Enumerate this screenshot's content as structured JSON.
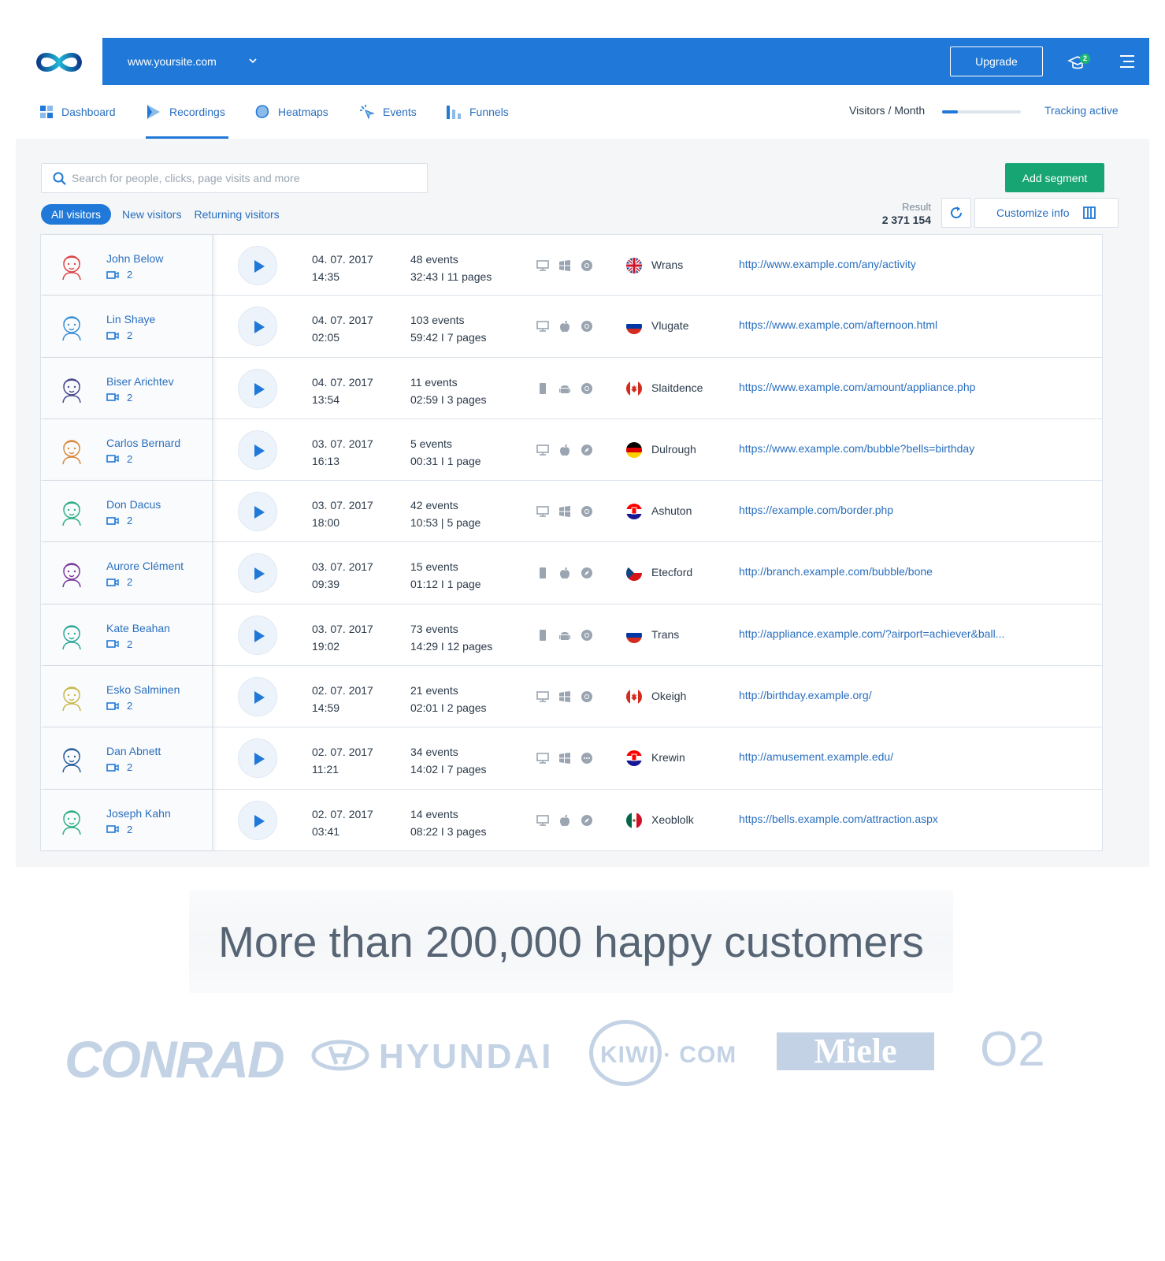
{
  "header": {
    "site": "www.yoursite.com",
    "upgrade_label": "Upgrade",
    "notification_count": "2"
  },
  "nav": {
    "items": [
      {
        "label": "Dashboard",
        "icon": "dashboard-icon"
      },
      {
        "label": "Recordings",
        "icon": "recordings-icon",
        "active": true
      },
      {
        "label": "Heatmaps",
        "icon": "heatmaps-icon"
      },
      {
        "label": "Events",
        "icon": "events-icon"
      },
      {
        "label": "Funnels",
        "icon": "funnels-icon"
      }
    ],
    "visitors_per_month_label": "Visitors / Month",
    "visitors_per_month_fill": 0.2,
    "tracking_label": "Tracking active"
  },
  "toolbar": {
    "search_placeholder": "Search for people, clicks, page visits and more",
    "add_segment_label": "Add segment",
    "filters": [
      "All visitors",
      "New visitors",
      "Returning visitors"
    ],
    "result_label": "Result",
    "result_value": "2 371 154",
    "customize_label": "Customize info"
  },
  "recordings": [
    {
      "name": "John Below",
      "recs": "2",
      "date": "04. 07. 2017",
      "time": "14:35",
      "events": "48 events",
      "duration": "32:43 I 11 pages",
      "device": "desktop",
      "os": "windows",
      "browser": "chrome",
      "flag": "uk",
      "city": "Wrans",
      "url": "http://www.example.com/any/activity",
      "color": "#d9484a"
    },
    {
      "name": "Lin Shaye",
      "recs": "2",
      "date": "04. 07. 2017",
      "time": "02:05",
      "events": "103 events",
      "duration": "59:42 I 7 pages",
      "device": "desktop",
      "os": "apple",
      "browser": "chrome",
      "flag": "ru",
      "city": "Vlugate",
      "url": "https://www.example.com/afternoon.html",
      "color": "#3a8fd6"
    },
    {
      "name": "Biser Arichtev",
      "recs": "2",
      "date": "04. 07. 2017",
      "time": "13:54",
      "events": "11 events",
      "duration": "02:59 I 3 pages",
      "device": "mobile",
      "os": "android",
      "browser": "chrome",
      "flag": "ca",
      "city": "Slaitdence",
      "url": "https://www.example.com/amount/appliance.php",
      "color": "#4a4a8c"
    },
    {
      "name": "Carlos Bernard",
      "recs": "2",
      "date": "03. 07. 2017",
      "time": "16:13",
      "events": "5 events",
      "duration": "00:31 I 1 page",
      "device": "desktop",
      "os": "apple",
      "browser": "safari",
      "flag": "de",
      "city": "Dulrough",
      "url": "https://www.example.com/bubble?bells=birthday",
      "color": "#d88a3c"
    },
    {
      "name": "Don Dacus",
      "recs": "2",
      "date": "03. 07. 2017",
      "time": "18:00",
      "events": "42 events",
      "duration": "10:53  |  5 page",
      "device": "desktop",
      "os": "windows",
      "browser": "chrome",
      "flag": "hr",
      "city": "Ashuton",
      "url": "https://example.com/border.php",
      "color": "#2fae86"
    },
    {
      "name": "Aurore Clément",
      "recs": "2",
      "date": "03. 07. 2017",
      "time": "09:39",
      "events": "15 events",
      "duration": "01:12 I 1 page",
      "device": "mobile",
      "os": "apple",
      "browser": "safari",
      "flag": "cz",
      "city": "Etecford",
      "url": "http://branch.example.com/bubble/bone",
      "color": "#7a3a9c"
    },
    {
      "name": "Kate Beahan",
      "recs": "2",
      "date": "03. 07. 2017",
      "time": "19:02",
      "events": "73 events",
      "duration": "14:29 I 12 pages",
      "device": "mobile",
      "os": "android",
      "browser": "chrome",
      "flag": "ru",
      "city": "Trans",
      "url": "http://appliance.example.com/?airport=achiever&ball...",
      "color": "#2ea79a"
    },
    {
      "name": "Esko Salminen",
      "recs": "2",
      "date": "02. 07. 2017",
      "time": "14:59",
      "events": "21 events",
      "duration": "02:01 I 2 pages",
      "device": "desktop",
      "os": "windows",
      "browser": "chrome",
      "flag": "ca",
      "city": "Okeigh",
      "url": "http://birthday.example.org/",
      "color": "#c9b84a"
    },
    {
      "name": "Dan Abnett",
      "recs": "2",
      "date": "02. 07. 2017",
      "time": "11:21",
      "events": "34 events",
      "duration": "14:02 I 7 pages",
      "device": "desktop",
      "os": "windows",
      "browser": "other",
      "flag": "hr",
      "city": "Krewin",
      "url": "http://amusement.example.edu/",
      "color": "#2a5f9c"
    },
    {
      "name": "Joseph Kahn",
      "recs": "2",
      "date": "02. 07. 2017",
      "time": "03:41",
      "events": "14 events",
      "duration": "08:22 I 3 pages",
      "device": "desktop",
      "os": "apple",
      "browser": "safari",
      "flag": "mx",
      "city": "Xeoblolk",
      "url": "https://bells.example.com/attraction.aspx",
      "color": "#2fae86"
    }
  ],
  "customers": {
    "title": "More than 200,000 happy customers",
    "logos": [
      "CONRAD",
      "HYUNDAI",
      "KIWI · COM",
      "Miele",
      "O2"
    ]
  },
  "colors": {
    "brand_blue": "#2079d8",
    "link_blue": "#2a6fbf",
    "green": "#17a673"
  }
}
